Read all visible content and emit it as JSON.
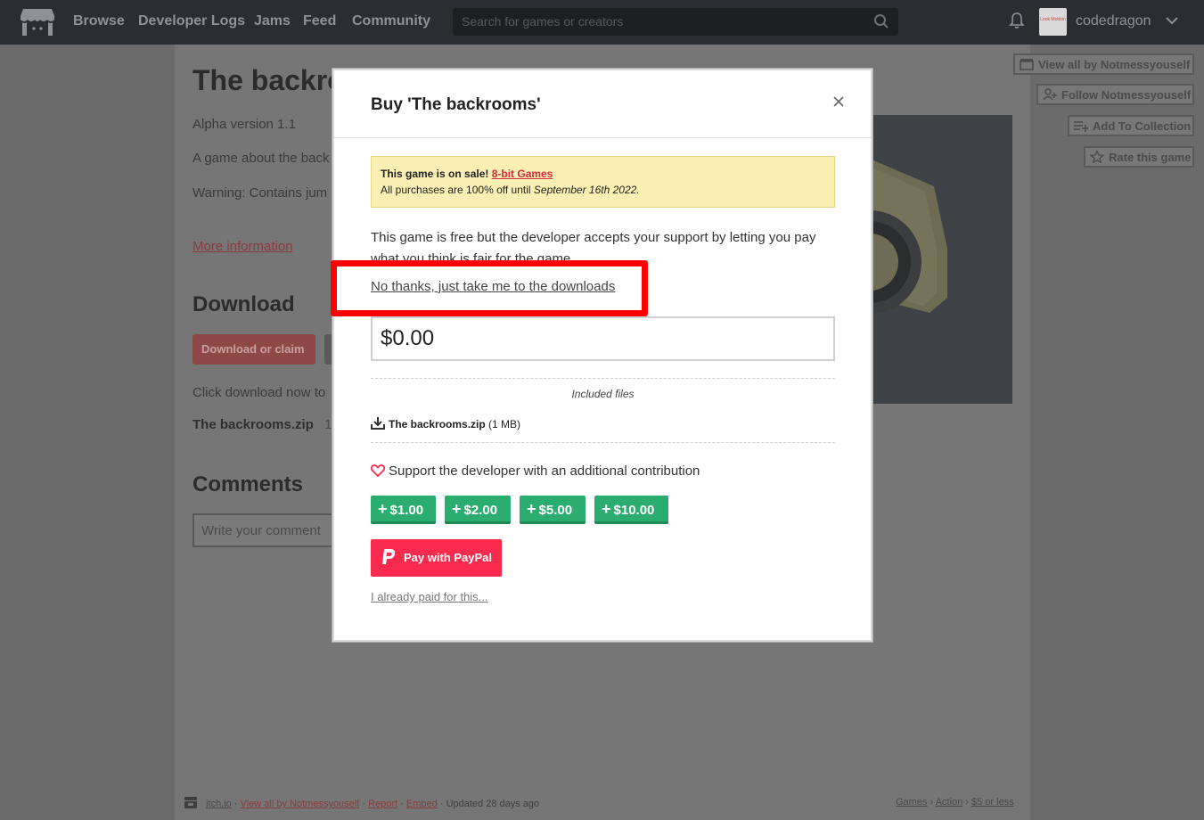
{
  "nav": {
    "links": [
      "Browse",
      "Developer Logs",
      "Jams",
      "Feed",
      "Community"
    ],
    "search_placeholder": "Search for games or creators",
    "username": "codedragon",
    "avatar_text": "Look Mobbin"
  },
  "background_page": {
    "title": "The backro",
    "lines": [
      "Alpha version 1.1",
      "A game about the back",
      "Warning: Contains jum"
    ],
    "more_info": "More information",
    "download_heading": "Download",
    "download_button": "Download or claim",
    "click_download": "Click download now to",
    "file_name": "The backrooms.zip",
    "file_size_partial": "1",
    "comments_heading": "Comments",
    "comment_placeholder": "Write your comment",
    "side_buttons": [
      "View all by Notmessyouself",
      "Follow Notmessyouself",
      "Add To Collection",
      "Rate this game"
    ],
    "footer": {
      "site": "itch.io",
      "view_all": "View all by Notmessyouself",
      "report": "Report",
      "embed": "Embed",
      "updated": "Updated 28 days ago",
      "tags": [
        "Games",
        "Action",
        "$5 or less"
      ]
    }
  },
  "modal": {
    "title": "Buy 'The backrooms'",
    "sale": {
      "prefix": "This game is on sale!",
      "link": "8-bit Games",
      "line2": "All purchases are 100% off until",
      "date": "September 16th 2022."
    },
    "description": "This game is free but the developer accepts your support by letting you pay what you think is fair for the game.",
    "no_thanks": "No thanks, just take me to the downloads",
    "price": "$0.00",
    "included_files_label": "Included files",
    "file": {
      "name": "The backrooms.zip",
      "size": "(1 MB)"
    },
    "support_text": "Support the developer with an additional contribution",
    "tips": [
      "$1.00",
      "$2.00",
      "$5.00",
      "$10.00"
    ],
    "paypal_label": "Pay with PayPal",
    "already_paid": "I already paid for this..."
  },
  "colors": {
    "accent": "#fa2b4f",
    "tip_green": "#2aad6f",
    "highlight": "#ff0000",
    "sale_bg": "#fcefb4"
  }
}
